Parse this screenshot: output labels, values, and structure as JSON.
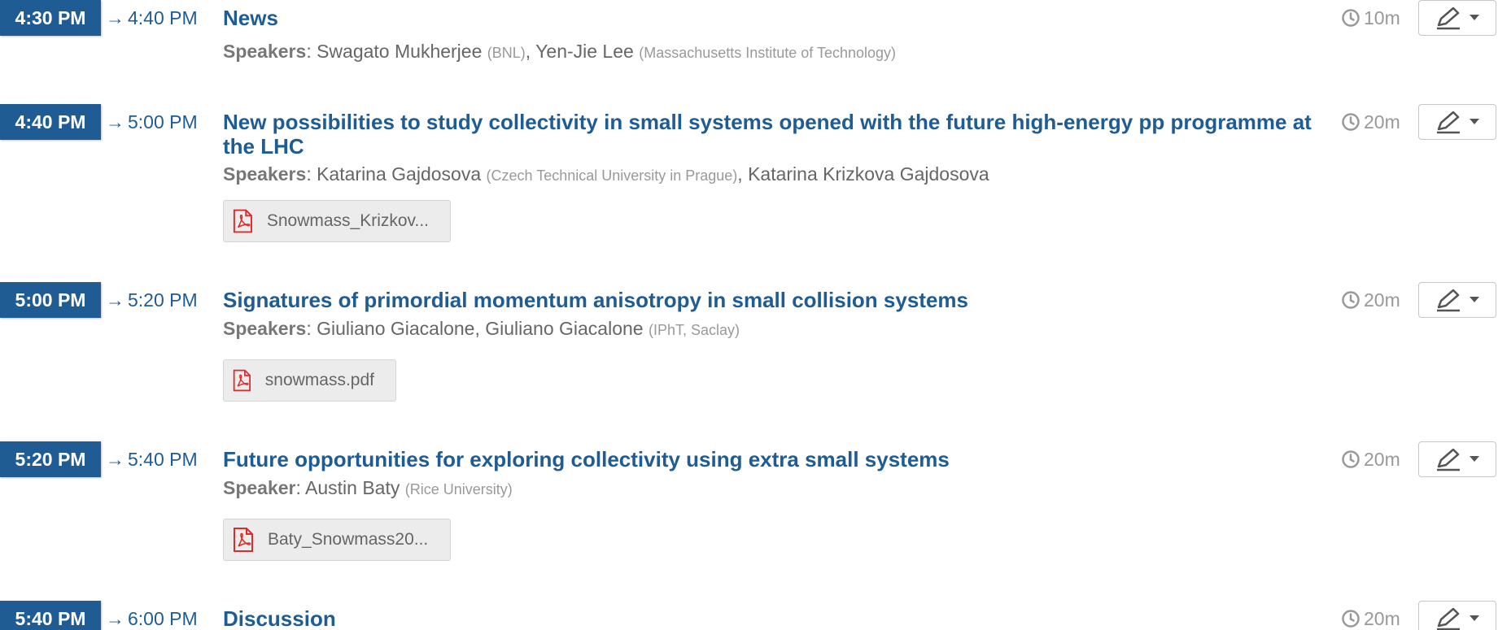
{
  "entries": [
    {
      "start": "4:30 PM",
      "end": "4:40 PM",
      "arrow": "→",
      "title": "News",
      "speakers_label": "Speakers",
      "speakers": [
        {
          "name": "Swagato Mukherjee",
          "affiliation": "(BNL)"
        },
        {
          "name": "Yen-Jie Lee",
          "affiliation": "(Massachusetts Institute of Technology)"
        }
      ],
      "duration": "10m"
    },
    {
      "start": "4:40 PM",
      "end": "5:00 PM",
      "arrow": "→",
      "title": "New possibilities to study collectivity in small systems opened with the future high-energy pp programme at the LHC",
      "speakers_label": "Speakers",
      "speakers": [
        {
          "name": "Katarina Gajdosova",
          "affiliation": "(Czech Technical University in Prague)"
        },
        {
          "name": "Katarina Krizkova Gajdosova",
          "affiliation": ""
        }
      ],
      "attachment": "Snowmass_Krizkov...",
      "duration": "20m"
    },
    {
      "start": "5:00 PM",
      "end": "5:20 PM",
      "arrow": "→",
      "title": "Signatures of primordial momentum anisotropy in small collision systems",
      "speakers_label": "Speakers",
      "speakers": [
        {
          "name": "Giuliano Giacalone",
          "affiliation": ""
        },
        {
          "name": "Giuliano Giacalone",
          "affiliation": "(IPhT, Saclay)"
        }
      ],
      "attachment": "snowmass.pdf",
      "duration": "20m"
    },
    {
      "start": "5:20 PM",
      "end": "5:40 PM",
      "arrow": "→",
      "title": "Future opportunities for exploring collectivity using extra small systems",
      "speakers_label": "Speaker",
      "speakers": [
        {
          "name": "Austin Baty",
          "affiliation": "(Rice University)"
        }
      ],
      "attachment": "Baty_Snowmass20...",
      "duration": "20m"
    },
    {
      "start": "5:40 PM",
      "end": "6:00 PM",
      "arrow": "→",
      "title": "Discussion",
      "duration": "20m"
    }
  ],
  "colors": {
    "accent": "#1f5c94",
    "pdf_red": "#e02a2a",
    "muted": "#999999"
  },
  "icons": {
    "clock": "clock-icon",
    "pdf": "pdf-file-icon",
    "edit": "pencil-icon",
    "dropdown": "caret-down-icon"
  }
}
